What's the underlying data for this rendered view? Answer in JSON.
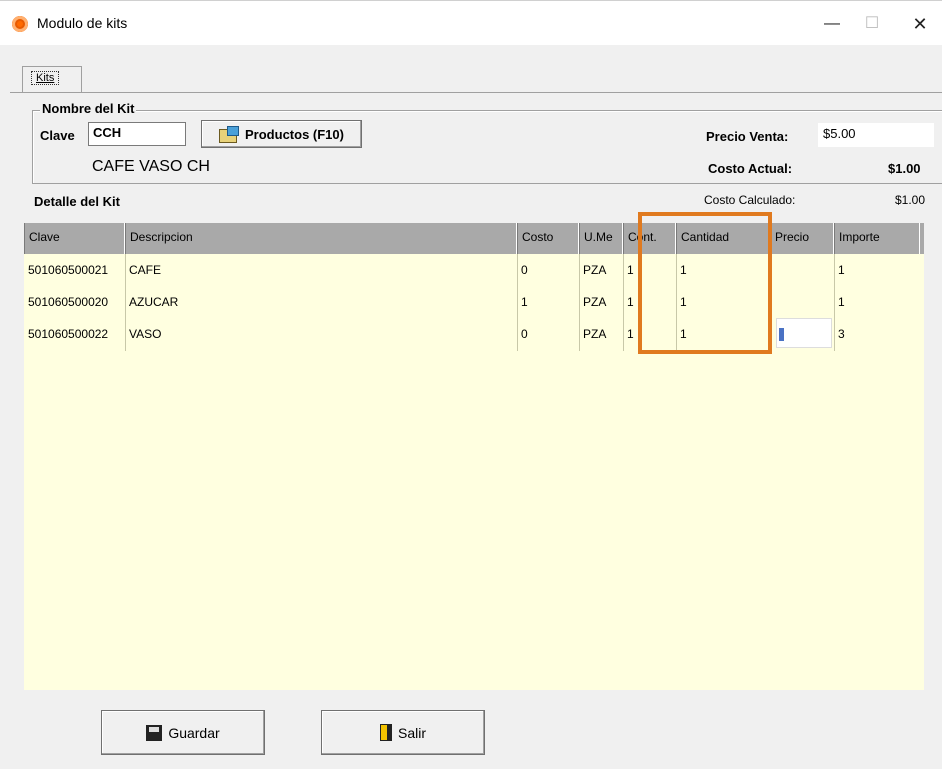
{
  "window": {
    "title": "Modulo de kits",
    "min": "—",
    "max": "☐",
    "close": "✕"
  },
  "tab": {
    "label": "Kits"
  },
  "kit": {
    "group_label": "Nombre del Kit",
    "clave_label": "Clave",
    "clave_value": "CCH",
    "productos_button": "Productos (F10)",
    "name": "CAFE VASO CH",
    "precio_venta_label": "Precio Venta:",
    "precio_venta_value": "$5.00",
    "costo_actual_label": "Costo Actual:",
    "costo_actual_value": "$1.00",
    "costo_calculado_label": "Costo Calculado:",
    "costo_calculado_value": "$1.00"
  },
  "detail": {
    "title": "Detalle del Kit",
    "columns": [
      "Clave",
      "Descripcion",
      "Costo",
      "U.Me",
      "Cont.",
      "Cantidad",
      "Precio",
      "Importe"
    ],
    "rows": [
      {
        "clave": "501060500021",
        "descripcion": "CAFE",
        "costo": "0",
        "ume": "PZA",
        "cont": "1",
        "cantidad": "1",
        "precio": "",
        "importe": "1"
      },
      {
        "clave": "501060500020",
        "descripcion": "AZUCAR",
        "costo": "1",
        "ume": "PZA",
        "cont": "1",
        "cantidad": "1",
        "precio": "",
        "importe": "1"
      },
      {
        "clave": "501060500022",
        "descripcion": "VASO",
        "costo": "0",
        "ume": "PZA",
        "cont": "1",
        "cantidad": "1",
        "precio": "",
        "importe": "3"
      }
    ]
  },
  "buttons": {
    "guardar": "Guardar",
    "salir": "Salir"
  },
  "colors": {
    "grid_bg": "#ffffe0",
    "header_bg": "#a9a9a9",
    "highlight": "#e07a1f"
  },
  "icons": [
    "app-logo-icon",
    "products-icon",
    "floppy-save-icon",
    "exit-door-icon"
  ]
}
